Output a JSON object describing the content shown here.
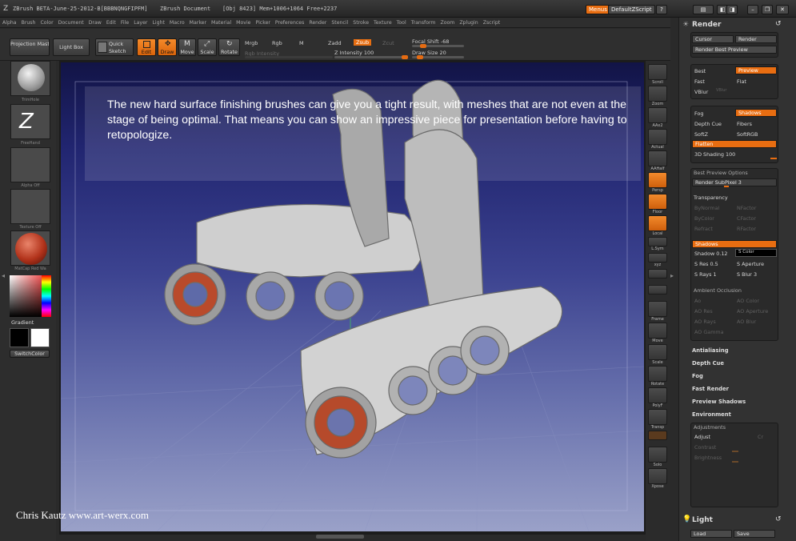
{
  "titlebar": {
    "app": "ZBrush BETA-June-25-2012-B[BBBNQNGFIPFM]",
    "document": "ZBrush Document",
    "stats": "[Obj 8423] Mem+1006+1064 Free+2237",
    "menus_label": "Menus",
    "script_label": "DefaultZScript"
  },
  "menubar": [
    "Alpha",
    "Brush",
    "Color",
    "Document",
    "Draw",
    "Edit",
    "File",
    "Layer",
    "Light",
    "Macro",
    "Marker",
    "Material",
    "Movie",
    "Picker",
    "Preferences",
    "Render",
    "Stencil",
    "Stroke",
    "Texture",
    "Tool",
    "Transform",
    "Zoom",
    "Zplugin",
    "Zscript"
  ],
  "toolbar": {
    "projection_master": "Projection Master",
    "light_box": "Light Box",
    "quick_sketch": "Quick Sketch",
    "edit": "Edit",
    "draw": "Draw",
    "move": "Move",
    "scale": "Scale",
    "rotate": "Rotate",
    "mrgb": "Mrgb",
    "rgb": "Rgb",
    "m": "M",
    "rgb_intensity": "Rgb Intensity",
    "zadd": "Zadd",
    "zsub": "Zsub",
    "zcut": "Zcut",
    "z_intensity": "Z Intensity 100",
    "focal_shift": "Focal Shift -68",
    "draw_size": "Draw Size 20"
  },
  "leftshelf": {
    "brush": "TrimHole",
    "stroke": "FreeHand",
    "alpha": "Alpha Off",
    "texture": "Texture Off",
    "material": "MatCap Red Wa",
    "gradient": "Gradient",
    "switch_color": "SwitchColor"
  },
  "canvas": {
    "caption": "The new hard surface finishing brushes can give you a tight result, with meshes that are not even at the stage of being optimal. That means you can show an impressive piece for presentation before having to retopologize.",
    "credit": "Chris Kautz www.art-werx.com"
  },
  "rightshelf": [
    "Scroll",
    "Zoom",
    "AAx2",
    "Actual",
    "AAHalf",
    "Persp",
    "Floor",
    "Local",
    "L.Sym",
    "xyz",
    "",
    "",
    "Frame",
    "Move",
    "Scale",
    "Rotate",
    "PolyF",
    "Transp",
    "",
    "Solo",
    "Xpose"
  ],
  "render_panel": {
    "title": "Render",
    "cursor": "Cursor",
    "render": "Render",
    "render_best_preview": "Render Best Preview",
    "best": "Best",
    "preview": "Preview",
    "fast": "Fast",
    "flat": "Flat",
    "vblur": "VBlur",
    "fog": "Fog",
    "shadows": "Shadows",
    "depth_cue": "Depth Cue",
    "fibers": "Fibers",
    "softz": "SoftZ",
    "softrgb": "SoftRGB",
    "flatten": "Flatten",
    "shading": "3D Shading 100",
    "best_preview_options": "Best Preview Options",
    "render_subpixel": "Render SubPixel 3",
    "transparency": "Transparency",
    "bynormal": "ByNormal",
    "nfactor": "NFactor",
    "bycolor": "ByColor",
    "cfactor": "CFactor",
    "refract": "Refract",
    "rfactor": "RFactor",
    "shadows_sub": "Shadows",
    "shadow": "Shadow 0.12",
    "s_color": "S Color",
    "s_res": "S Res 0.5",
    "s_aperture": "S Aperture",
    "s_rays": "S Rays 1",
    "s_blur": "S Blur 3",
    "ambient_occlusion": "Ambient Occlusion",
    "ao": "Ao",
    "ao_color": "AO Color",
    "ao_res": "AO Res",
    "ao_aperture": "AO Aperture",
    "ao_rays": "AO Rays",
    "ao_blur": "AO Blur",
    "ao_gamma": "AO Gamma",
    "antialiasing": "Antialiasing",
    "depth_cue_sub": "Depth Cue",
    "fog_sub": "Fog",
    "fast_render": "Fast Render",
    "preview_shadows": "Preview Shadows",
    "environment": "Environment",
    "adjustments": "Adjustments",
    "adjust": "Adjust",
    "cr": "Cr",
    "contrast": "Contrast",
    "brightness": "Brightness",
    "light": "Light",
    "load": "Load",
    "save": "Save"
  },
  "colors": {
    "accent": "#e86d11",
    "bg": "#2f2f2f"
  }
}
